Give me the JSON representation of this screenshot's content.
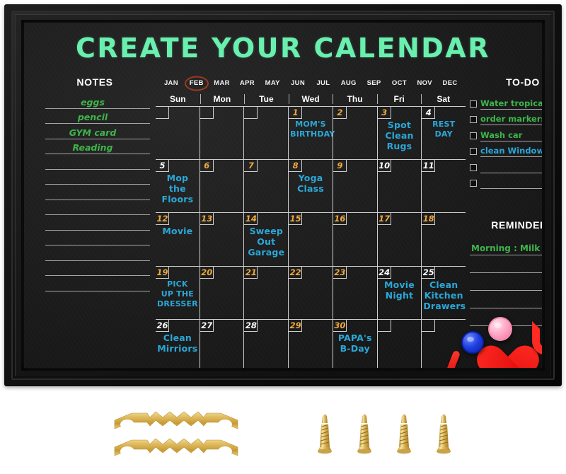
{
  "title": "CREATE YOUR CALENDAR",
  "months": {
    "labels": [
      "JAN",
      "FEB",
      "MAR",
      "APR",
      "MAY",
      "JUN",
      "JUL",
      "AUG",
      "SEP",
      "OCT",
      "NOV",
      "DEC"
    ],
    "selected": "FEB",
    "selected_index": 1,
    "circle_color": "#9c3a1e"
  },
  "weekdays": [
    "Sun",
    "Mon",
    "Tue",
    "Wed",
    "Thu",
    "Fri",
    "Sat"
  ],
  "notes": {
    "heading": "NOTES",
    "items": [
      "eggs",
      "pencil",
      "GYM card",
      "Reading",
      "",
      "",
      "",
      "",
      "",
      "",
      "",
      "",
      ""
    ],
    "line_count": 13,
    "ink_color": "#3db54a"
  },
  "todo": {
    "heading": "TO-DO",
    "items": [
      {
        "label": "Water tropical plants",
        "color": "green",
        "checked": false
      },
      {
        "label": "order markers",
        "color": "green",
        "checked": false
      },
      {
        "label": "Wash car",
        "color": "green",
        "checked": false
      },
      {
        "label": "clean Windows",
        "color": "blue",
        "checked": false
      },
      {
        "label": "",
        "color": "green",
        "checked": false
      },
      {
        "label": "",
        "color": "green",
        "checked": false
      }
    ]
  },
  "reminders": {
    "heading": "REMINDERS",
    "items": [
      "Morning : Milk",
      "",
      "",
      "",
      ""
    ],
    "line_count": 5,
    "ink_color": "#3db54a"
  },
  "calendar": {
    "event_ink": "#2aa8d8",
    "date_gold": "#f0a93c",
    "date_white": "#ffffff",
    "weeks": [
      [
        {
          "date": "",
          "num_color": "white",
          "event": ""
        },
        {
          "date": "",
          "num_color": "white",
          "event": ""
        },
        {
          "date": "",
          "num_color": "white",
          "event": ""
        },
        {
          "date": "1",
          "num_color": "gold",
          "event": "MOM'S\nBIRTHDAY",
          "small": true
        },
        {
          "date": "2",
          "num_color": "gold",
          "event": ""
        },
        {
          "date": "3",
          "num_color": "gold",
          "event": "Spot\nClean\nRugs"
        },
        {
          "date": "4",
          "num_color": "white",
          "event": "REST\nDAY",
          "small": true
        }
      ],
      [
        {
          "date": "5",
          "num_color": "white",
          "event": "Mop\nthe\nFloors"
        },
        {
          "date": "6",
          "num_color": "gold",
          "event": ""
        },
        {
          "date": "7",
          "num_color": "gold",
          "event": ""
        },
        {
          "date": "8",
          "num_color": "gold",
          "event": "Yoga\nClass"
        },
        {
          "date": "9",
          "num_color": "gold",
          "event": ""
        },
        {
          "date": "10",
          "num_color": "white",
          "event": ""
        },
        {
          "date": "11",
          "num_color": "white",
          "event": ""
        }
      ],
      [
        {
          "date": "12",
          "num_color": "gold",
          "event": "Movie"
        },
        {
          "date": "13",
          "num_color": "gold",
          "event": ""
        },
        {
          "date": "14",
          "num_color": "gold",
          "event": "Sweep\nOut\nGarage"
        },
        {
          "date": "15",
          "num_color": "gold",
          "event": ""
        },
        {
          "date": "16",
          "num_color": "gold",
          "event": ""
        },
        {
          "date": "17",
          "num_color": "gold",
          "event": ""
        },
        {
          "date": "18",
          "num_color": "gold",
          "event": ""
        }
      ],
      [
        {
          "date": "19",
          "num_color": "gold",
          "event": "PICK\nUP THE\nDRESSER",
          "small": true
        },
        {
          "date": "20",
          "num_color": "gold",
          "event": ""
        },
        {
          "date": "21",
          "num_color": "gold",
          "event": ""
        },
        {
          "date": "22",
          "num_color": "gold",
          "event": ""
        },
        {
          "date": "23",
          "num_color": "gold",
          "event": ""
        },
        {
          "date": "24",
          "num_color": "white",
          "event": "Movie\nNight"
        },
        {
          "date": "25",
          "num_color": "white",
          "event": "Clean\nKitchen\nDrawers"
        }
      ],
      [
        {
          "date": "26",
          "num_color": "white",
          "event": "Clean\nMirriors"
        },
        {
          "date": "27",
          "num_color": "white",
          "event": ""
        },
        {
          "date": "28",
          "num_color": "white",
          "event": ""
        },
        {
          "date": "29",
          "num_color": "gold",
          "event": ""
        },
        {
          "date": "30",
          "num_color": "gold",
          "event": "PAPA's\nB-Day"
        },
        {
          "date": "",
          "num_color": "white",
          "event": ""
        },
        {
          "date": "",
          "num_color": "white",
          "event": ""
        }
      ]
    ]
  },
  "decor": {
    "heart": "red-heart-magnet",
    "letter_i": "I",
    "letter_u": "U",
    "magnet_blue": "blue-round-magnet",
    "magnet_pink": "pink-round-magnet"
  },
  "hardware": {
    "hangers": [
      "sawtooth-hanger",
      "sawtooth-hanger"
    ],
    "screws": [
      "brass-screw",
      "brass-screw",
      "brass-screw",
      "brass-screw"
    ],
    "metal_color": "#d4ab4e"
  }
}
